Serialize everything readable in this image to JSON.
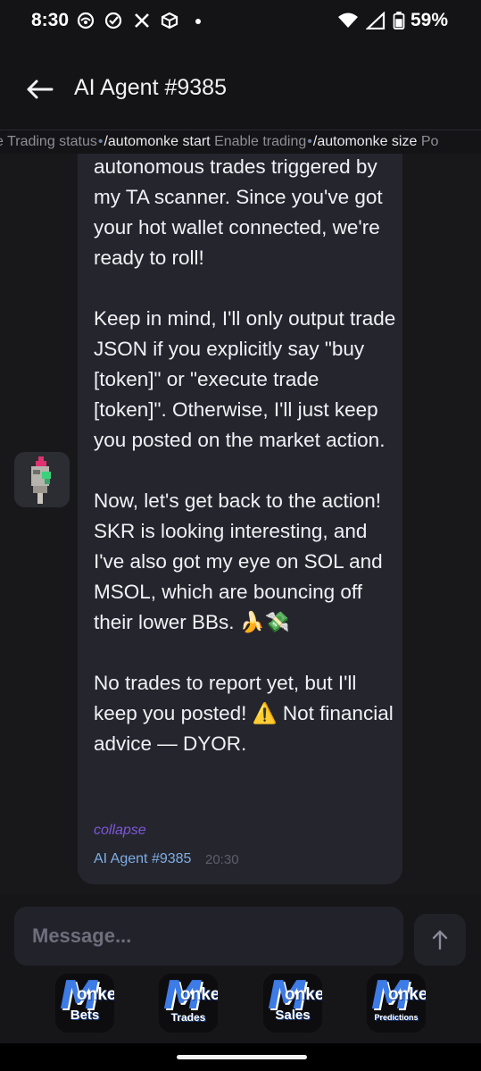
{
  "status_bar": {
    "time": "8:30",
    "battery": "59%",
    "icons": [
      "hotspot-icon",
      "check-circle-icon",
      "x-icon",
      "app-cube-icon",
      "dot-icon",
      "wifi-icon",
      "signal-icon",
      "battery-icon"
    ]
  },
  "header": {
    "title": "AI Agent #9385",
    "back_icon": "back-arrow-icon"
  },
  "commands": [
    {
      "name": "",
      "desc": "ke Trading status"
    },
    {
      "name": "/automonke start",
      "desc": "Enable trading"
    },
    {
      "name": "/automonke size",
      "desc": "Po"
    }
  ],
  "message": {
    "paragraphs": [
      "autonomous trades triggered by my TA scanner. Since you've got your hot wallet connected, we're ready to roll!",
      "Keep in mind, I'll only output trade JSON if you explicitly say \"buy [token]\" or \"execute trade [token]\". Otherwise, I'll just keep you posted on the market action.",
      "Now, let's get back to the action! SKR is looking interesting, and I've also got my eye on SOL and MSOL, which are bouncing off their lower BBs. 🍌💸",
      "No trades to report yet, but I'll keep you posted! ⚠️ Not financial advice — DYOR."
    ],
    "collapse_label": "collapse",
    "sender": "AI Agent #9385",
    "time": "20:30"
  },
  "composer": {
    "placeholder": "Message...",
    "send_icon": "send-arrow-icon"
  },
  "apps": [
    {
      "letter": "M",
      "suffix": "onke",
      "label": "Bets"
    },
    {
      "letter": "M",
      "suffix": "onke",
      "label": "Trades"
    },
    {
      "letter": "M",
      "suffix": "onke",
      "label": "Sales"
    },
    {
      "letter": "M",
      "suffix": "onke",
      "label": "Predictions"
    }
  ],
  "colors": {
    "background": "#18181b",
    "bubble": "#25252e",
    "accent_link": "#7d57d8",
    "sender": "#7eaee3",
    "app_blue": "#3d7be6"
  }
}
